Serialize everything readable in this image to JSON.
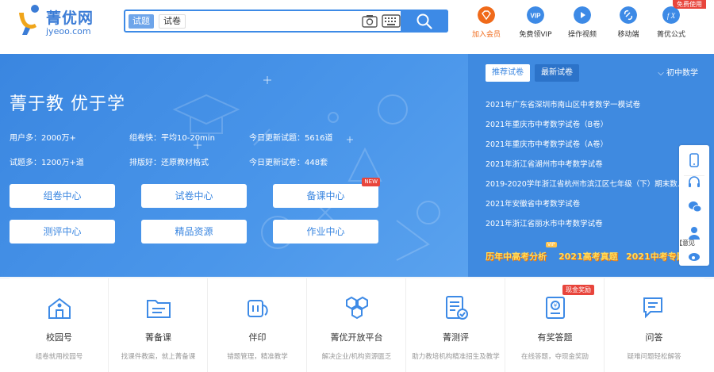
{
  "logo": {
    "name": "菁优网",
    "sub": "jyeoo.com"
  },
  "search": {
    "tabs": [
      "试题",
      "试卷"
    ],
    "placeholder": ""
  },
  "topnav": [
    {
      "label": "加入会员",
      "icon": "vip-diamond-icon",
      "color": "#f06a1a"
    },
    {
      "label": "免费领VIP",
      "icon": "vip-icon",
      "color": "#3d8ae6"
    },
    {
      "label": "操作视频",
      "icon": "play-icon",
      "color": "#3d8ae6"
    },
    {
      "label": "移动端",
      "icon": "mobile-link-icon",
      "color": "#3d8ae6"
    },
    {
      "label": "菁优公式",
      "icon": "formula-icon",
      "color": "#3d8ae6",
      "badge": "免费使用"
    }
  ],
  "hero": {
    "slogan": "菁于教 优于学",
    "stats": [
      "用户多：2000万+",
      "组卷快：平均10-20min",
      "今日更新试题：5616道",
      "试题多：1200万+道",
      "排版好：还原教材格式",
      "今日更新试卷：448套"
    ],
    "buttons": [
      {
        "label": "组卷中心"
      },
      {
        "label": "试卷中心"
      },
      {
        "label": "备课中心",
        "badge": "NEW"
      },
      {
        "label": "测评中心"
      },
      {
        "label": "精品资源"
      },
      {
        "label": "作业中心"
      }
    ]
  },
  "panel": {
    "tabs": [
      "推荐试卷",
      "最新试卷"
    ],
    "subject": "初中数学",
    "papers": [
      "2021年广东省深圳市南山区中考数学一模试卷",
      "2021年重庆市中考数学试卷（B卷）",
      "2021年重庆市中考数学试卷（A卷）",
      "2021年浙江省湖州市中考数学试卷",
      "2019-2020学年浙江省杭州市滨江区七年级（下）期末数学试卷",
      "2021年安徽省中考数学试卷",
      "2021年浙江省丽水市中考数学试卷"
    ],
    "promo": [
      "历年中高考分析",
      "2021高考真题",
      "2021中考专题"
    ],
    "promo_tag": "VIP"
  },
  "sidebar": {
    "items": [
      "mobile-icon",
      "headset-icon",
      "wechat-icon",
      "user-feedback-icon",
      "weibo-icon"
    ],
    "feedback_label": "【意见"
  },
  "features": [
    {
      "title": "校园号",
      "desc": "组卷就用校园号"
    },
    {
      "title": "菁备课",
      "desc": "找课件教案，就上菁备课"
    },
    {
      "title": "伴印",
      "desc": "错题管理，精准教学"
    },
    {
      "title": "菁优开放平台",
      "desc": "解决企业/机构资源匮乏"
    },
    {
      "title": "菁测评",
      "desc": "助力教培机构精准招生及教学"
    },
    {
      "title": "有奖答题",
      "desc": "在线答题，夺现金奖励",
      "badge": "现金奖励"
    },
    {
      "title": "问答",
      "desc": "疑难问题轻松解答"
    }
  ],
  "colors": {
    "brand": "#3d8ae6",
    "accent": "#f06a1a",
    "promo": "#ffdc5a"
  }
}
